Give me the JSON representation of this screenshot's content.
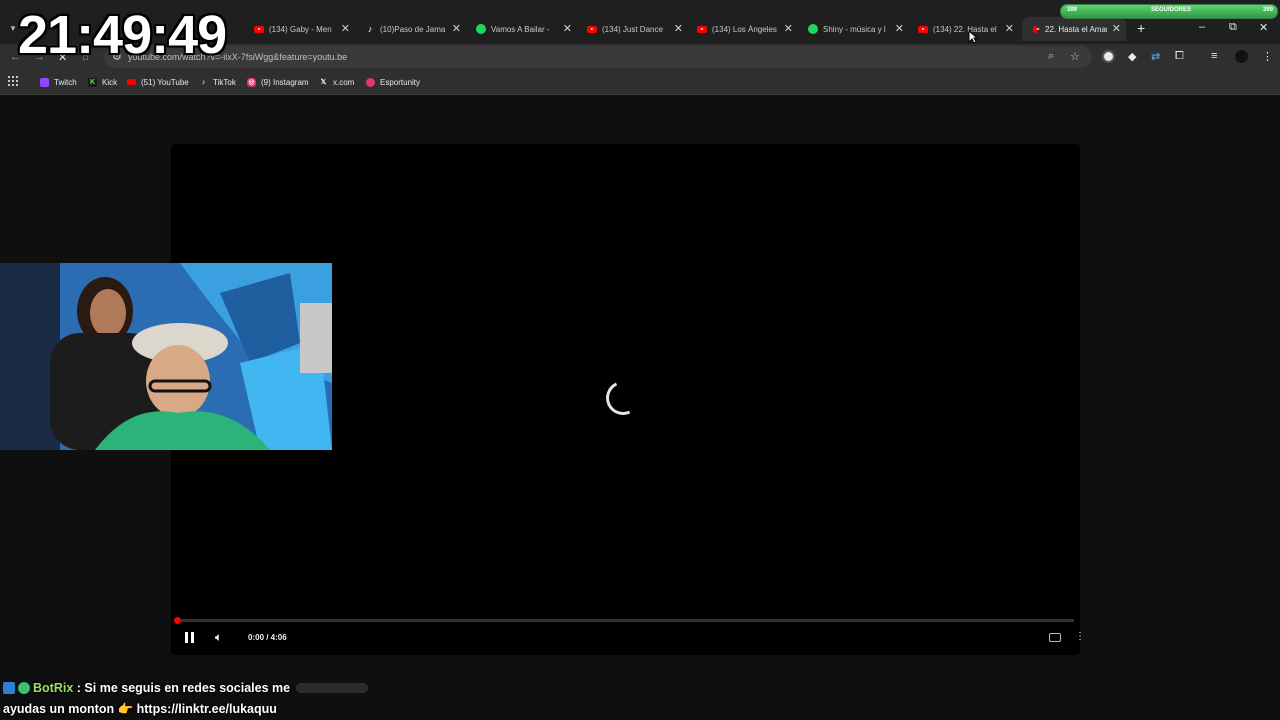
{
  "clock": "21:49:49",
  "tabs": [
    {
      "title": "(134) Gaby - Men",
      "favicon": "youtube-icon"
    },
    {
      "title": "(10)Paso de Jama",
      "favicon": "tiktok-icon"
    },
    {
      "title": "Vamos A Bailar -",
      "favicon": "spotify-icon"
    },
    {
      "title": "(134) Just Dance",
      "favicon": "youtube-icon"
    },
    {
      "title": "(134) Los Ángeles",
      "favicon": "youtube-icon"
    },
    {
      "title": "Shiny - música y l",
      "favicon": "spotify-icon"
    },
    {
      "title": "(134) 22. Hasta el",
      "favicon": "youtube-icon"
    },
    {
      "title": "22. Hasta el Amar",
      "favicon": "youtube-icon",
      "active": true
    }
  ],
  "follower_goal": {
    "label": "SEGUIDORES",
    "current": "399",
    "target": "399",
    "progress": 1.0
  },
  "address_bar": {
    "url": "youtube.com/watch?v=-iixX-7fsiWgg&feature=youtu.be"
  },
  "bookmarks": [
    {
      "label": "Twitch",
      "icon": "twitch-icon",
      "color": "#9146ff"
    },
    {
      "label": "Kick",
      "icon": "kick-icon",
      "color": "#53fc18"
    },
    {
      "label": "(51) YouTube",
      "icon": "youtube-icon",
      "color": "#ff0000"
    },
    {
      "label": "TikTok",
      "icon": "tiktok-icon",
      "color": "#000000"
    },
    {
      "label": "(9) Instagram",
      "icon": "instagram-icon",
      "color": "#e1306c"
    },
    {
      "label": "x.com",
      "icon": "x-icon",
      "color": "#000000"
    },
    {
      "label": "Esportunity",
      "icon": "esportunity-icon",
      "color": "#e8336d"
    }
  ],
  "player": {
    "time": "0:00 / 4:06",
    "progress": 0.0,
    "state": "loading"
  },
  "chat": {
    "user": "BotRix",
    "separator": ":",
    "message_line1": "Si me seguis en redes sociales me",
    "message_line2": "ayudas un monton 👉 https://linktr.ee/lukaquu"
  },
  "colors": {
    "accent": "#ff0000",
    "goal": "#4fc15f",
    "chat_user": "#9be15d"
  }
}
